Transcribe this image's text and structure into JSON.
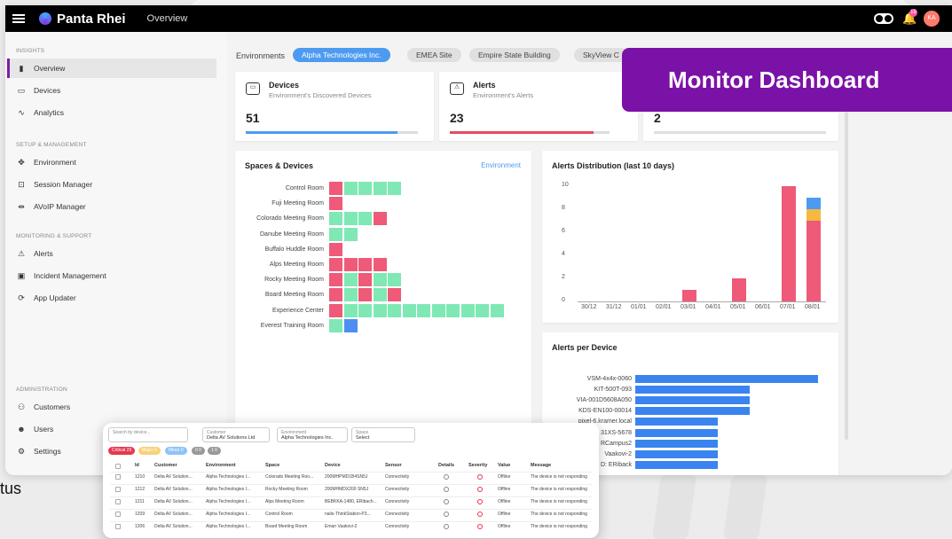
{
  "app": {
    "brand": "Panta Rhei",
    "page": "Overview",
    "notif_count": "19",
    "avatar_initials": "KA"
  },
  "sidebar": {
    "sections": [
      {
        "title": "INSIGHTS",
        "items": [
          {
            "label": "Overview",
            "icon": "bar-chart-icon"
          },
          {
            "label": "Devices",
            "icon": "devices-icon"
          },
          {
            "label": "Analytics",
            "icon": "line-chart-icon"
          }
        ]
      },
      {
        "title": "SETUP & MANAGEMENT",
        "items": [
          {
            "label": "Environment",
            "icon": "environment-icon"
          },
          {
            "label": "Session Manager",
            "icon": "session-icon"
          },
          {
            "label": "AVoIP Manager",
            "icon": "avoip-icon"
          }
        ]
      },
      {
        "title": "MONITORING & SUPPORT",
        "items": [
          {
            "label": "Alerts",
            "icon": "alert-icon"
          },
          {
            "label": "Incident Management",
            "icon": "incident-icon"
          },
          {
            "label": "App Updater",
            "icon": "updater-icon"
          }
        ]
      },
      {
        "title": "ADMINISTRATION",
        "items": [
          {
            "label": "Customers",
            "icon": "customers-icon"
          },
          {
            "label": "Users",
            "icon": "users-icon"
          },
          {
            "label": "Settings",
            "icon": "settings-icon"
          }
        ]
      }
    ]
  },
  "environments": {
    "label": "Environments",
    "chips": [
      "Alpha Technologies Inc.",
      "EMEA Site",
      "Empire State Building",
      "SkyView C"
    ]
  },
  "stats": [
    {
      "title": "Devices",
      "sub": "Environment's Discovered Devices",
      "value": "51",
      "progress": 0.88,
      "color": "#4d9bf0"
    },
    {
      "title": "Alerts",
      "sub": "Environment's Alerts",
      "value": "23",
      "progress": 0.9,
      "color": "#e84a5f"
    },
    {
      "title": "",
      "sub": "",
      "value": "2",
      "progress": 1.0,
      "color": "#e0e0e0"
    }
  ],
  "banner": "Monitor Dashboard",
  "spaces": {
    "title": "Spaces & Devices",
    "link": "Environment",
    "rooms": [
      {
        "name": "Control Room",
        "cells": "rgggg"
      },
      {
        "name": "Fuji Meeting Room",
        "cells": "r"
      },
      {
        "name": "Colorado Meeting Room",
        "cells": "gggr"
      },
      {
        "name": "Danube Meeting Room",
        "cells": "gg"
      },
      {
        "name": "Buffalo Huddle Room",
        "cells": "r"
      },
      {
        "name": "Alps Meeting Room",
        "cells": "rrrr"
      },
      {
        "name": "Rocky Meeting Room",
        "cells": "rgrgg"
      },
      {
        "name": "Board Meeting Room",
        "cells": "rgrgr"
      },
      {
        "name": "Experience Center",
        "cells": "rggggggggggg"
      },
      {
        "name": "Everest Training Room",
        "cells": "gb"
      }
    ]
  },
  "chart_data": [
    {
      "type": "bar",
      "title": "Alerts Distribution (last 10 days)",
      "categories": [
        "30/12",
        "31/12",
        "01/01",
        "02/01",
        "03/01",
        "04/01",
        "05/01",
        "06/01",
        "07/01",
        "08/01"
      ],
      "series": [
        {
          "values": [
            0,
            0,
            0,
            0,
            1,
            0,
            2,
            0,
            10,
            7
          ],
          "color": "#ee5a78"
        },
        {
          "values": [
            0,
            0,
            0,
            0,
            0,
            0,
            0,
            0,
            0,
            1
          ],
          "color": "#f5b942"
        },
        {
          "values": [
            0,
            0,
            0,
            0,
            0,
            0,
            0,
            0,
            0,
            1
          ],
          "color": "#4d9bf0"
        }
      ],
      "ylim": [
        0,
        10
      ],
      "yticks": [
        "0",
        "2",
        "4",
        "6",
        "8",
        "10"
      ]
    },
    {
      "type": "bar",
      "orientation": "horizontal",
      "title": "Alerts per Device",
      "categories": [
        "VSM-4x4x-0060",
        "KIT-500T-093",
        "VIA-001D5608A050",
        "KDS-EN100-00014",
        "pixel-6.kramer.local",
        "31XS-5678",
        "RCampus2",
        "Vaakovi-2",
        "D: ERiback"
      ],
      "values": [
        4,
        2.5,
        2.5,
        2.5,
        1.8,
        1.8,
        1.8,
        1.8,
        1.8
      ],
      "xlim": [
        0,
        4
      ]
    }
  ],
  "table": {
    "filters": [
      {
        "label": "Search by device...",
        "value": ""
      },
      {
        "label": "Customer",
        "value": "Delta AV Solutions Ltd"
      },
      {
        "label": "Environment",
        "value": "Alpha Technologies Inc."
      },
      {
        "label": "Space",
        "value": "Select"
      }
    ],
    "badges": [
      {
        "label": "Critical 29",
        "color": "#e53950"
      },
      {
        "label": "Major 0",
        "color": "#f7d27a"
      },
      {
        "label": "Minor 0",
        "color": "#8fc3f5"
      },
      {
        "label": "0 0",
        "color": "#999"
      },
      {
        "label": "1 0",
        "color": "#999"
      }
    ],
    "columns": [
      "Id",
      "Customer",
      "Environment",
      "Space",
      "Device",
      "Sensor",
      "Details",
      "Severity",
      "Value",
      "Message"
    ],
    "rows": [
      [
        "1210",
        "Delta AV Solution...",
        "Alpha Technologies I...",
        "Colorado Meeting Roo...",
        "200MHPMD1B4SN5J",
        "Connectivity",
        "",
        "",
        "Offline",
        "The device is not responding"
      ],
      [
        "1212",
        "Delta AV Solution...",
        "Alpha Technologies I...",
        "Rocky Meeting Room",
        "200MHMDX200 SN5J",
        "Connectivity",
        "",
        "",
        "Offline",
        "The device is not responding"
      ],
      [
        "1211",
        "Delta AV Solution...",
        "Alpha Technologies I...",
        "Alps Meeting Room",
        "BEBKKA-1480, ERibach...",
        "Connectivity",
        "",
        "",
        "Offline",
        "The device is not responding"
      ],
      [
        "1209",
        "Delta AV Solution...",
        "Alpha Technologies I...",
        "Control Room",
        "nails-ThinkStation-P3...",
        "Connectivity",
        "",
        "",
        "Offline",
        "The device is not responding"
      ],
      [
        "1206",
        "Delta AV Solution...",
        "Alpha Technologies I...",
        "Board Meeting Room",
        "Eman Vaakovi-2",
        "Connectivity",
        "",
        "",
        "Offline",
        "The device is not responding"
      ]
    ]
  },
  "footer_fragment": "tus"
}
